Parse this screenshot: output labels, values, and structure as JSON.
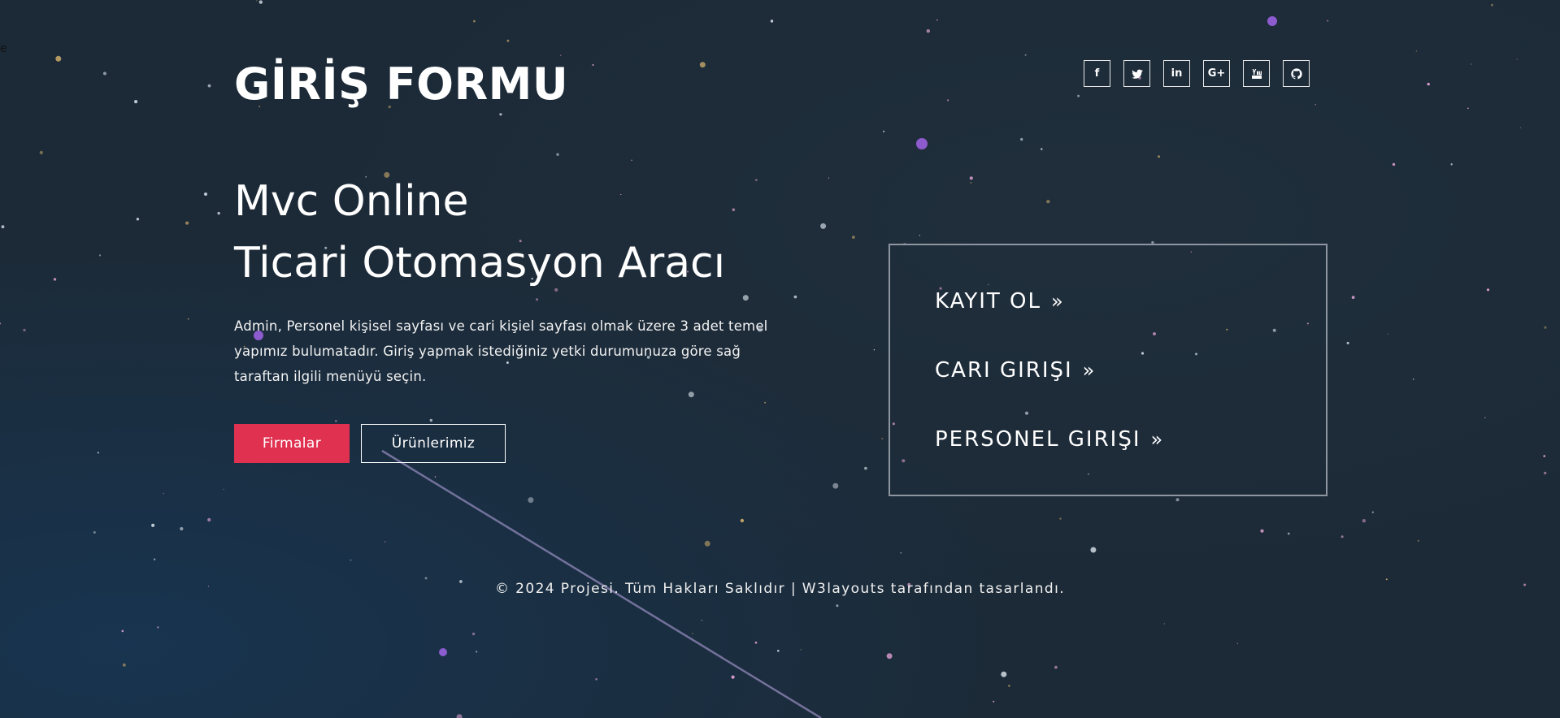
{
  "stray_text": "e",
  "header": {
    "title": "GİRİŞ FORMU",
    "social": [
      {
        "icon": "facebook-icon",
        "glyph": "f"
      },
      {
        "icon": "twitter-icon",
        "glyph": ""
      },
      {
        "icon": "linkedin-icon",
        "glyph": "in"
      },
      {
        "icon": "google-plus-icon",
        "glyph": "G+"
      },
      {
        "icon": "youtube-icon",
        "glyph": ""
      },
      {
        "icon": "github-icon",
        "glyph": ""
      }
    ]
  },
  "hero": {
    "line1": "Mvc Online",
    "line2": "Ticari Otomasyon Aracı",
    "description": "Admin, Personel kişisel sayfası ve cari kişiel sayfası olmak üzere 3 adet temel yapımız bulumatadır. Giriş yapmak istediğiniz yetki durumunuza göre sağ taraftan ilgili menüyü seçin."
  },
  "buttons": {
    "primary": "Firmalar",
    "secondary": "Ürünlerimiz"
  },
  "menu": {
    "items": [
      {
        "label": "KAYIT OL",
        "arrow": "»"
      },
      {
        "label": "CARI GIRIŞI",
        "arrow": "»"
      },
      {
        "label": "PERSONEL GIRIŞI",
        "arrow": "»"
      }
    ]
  },
  "footer": {
    "text": "© 2024 Projesi. Tüm Hakları Saklıdır | W3layouts tarafından tasarlandı."
  },
  "colors": {
    "background": "#1c2a37",
    "accent": "#e03150",
    "border": "#8d96a0"
  }
}
